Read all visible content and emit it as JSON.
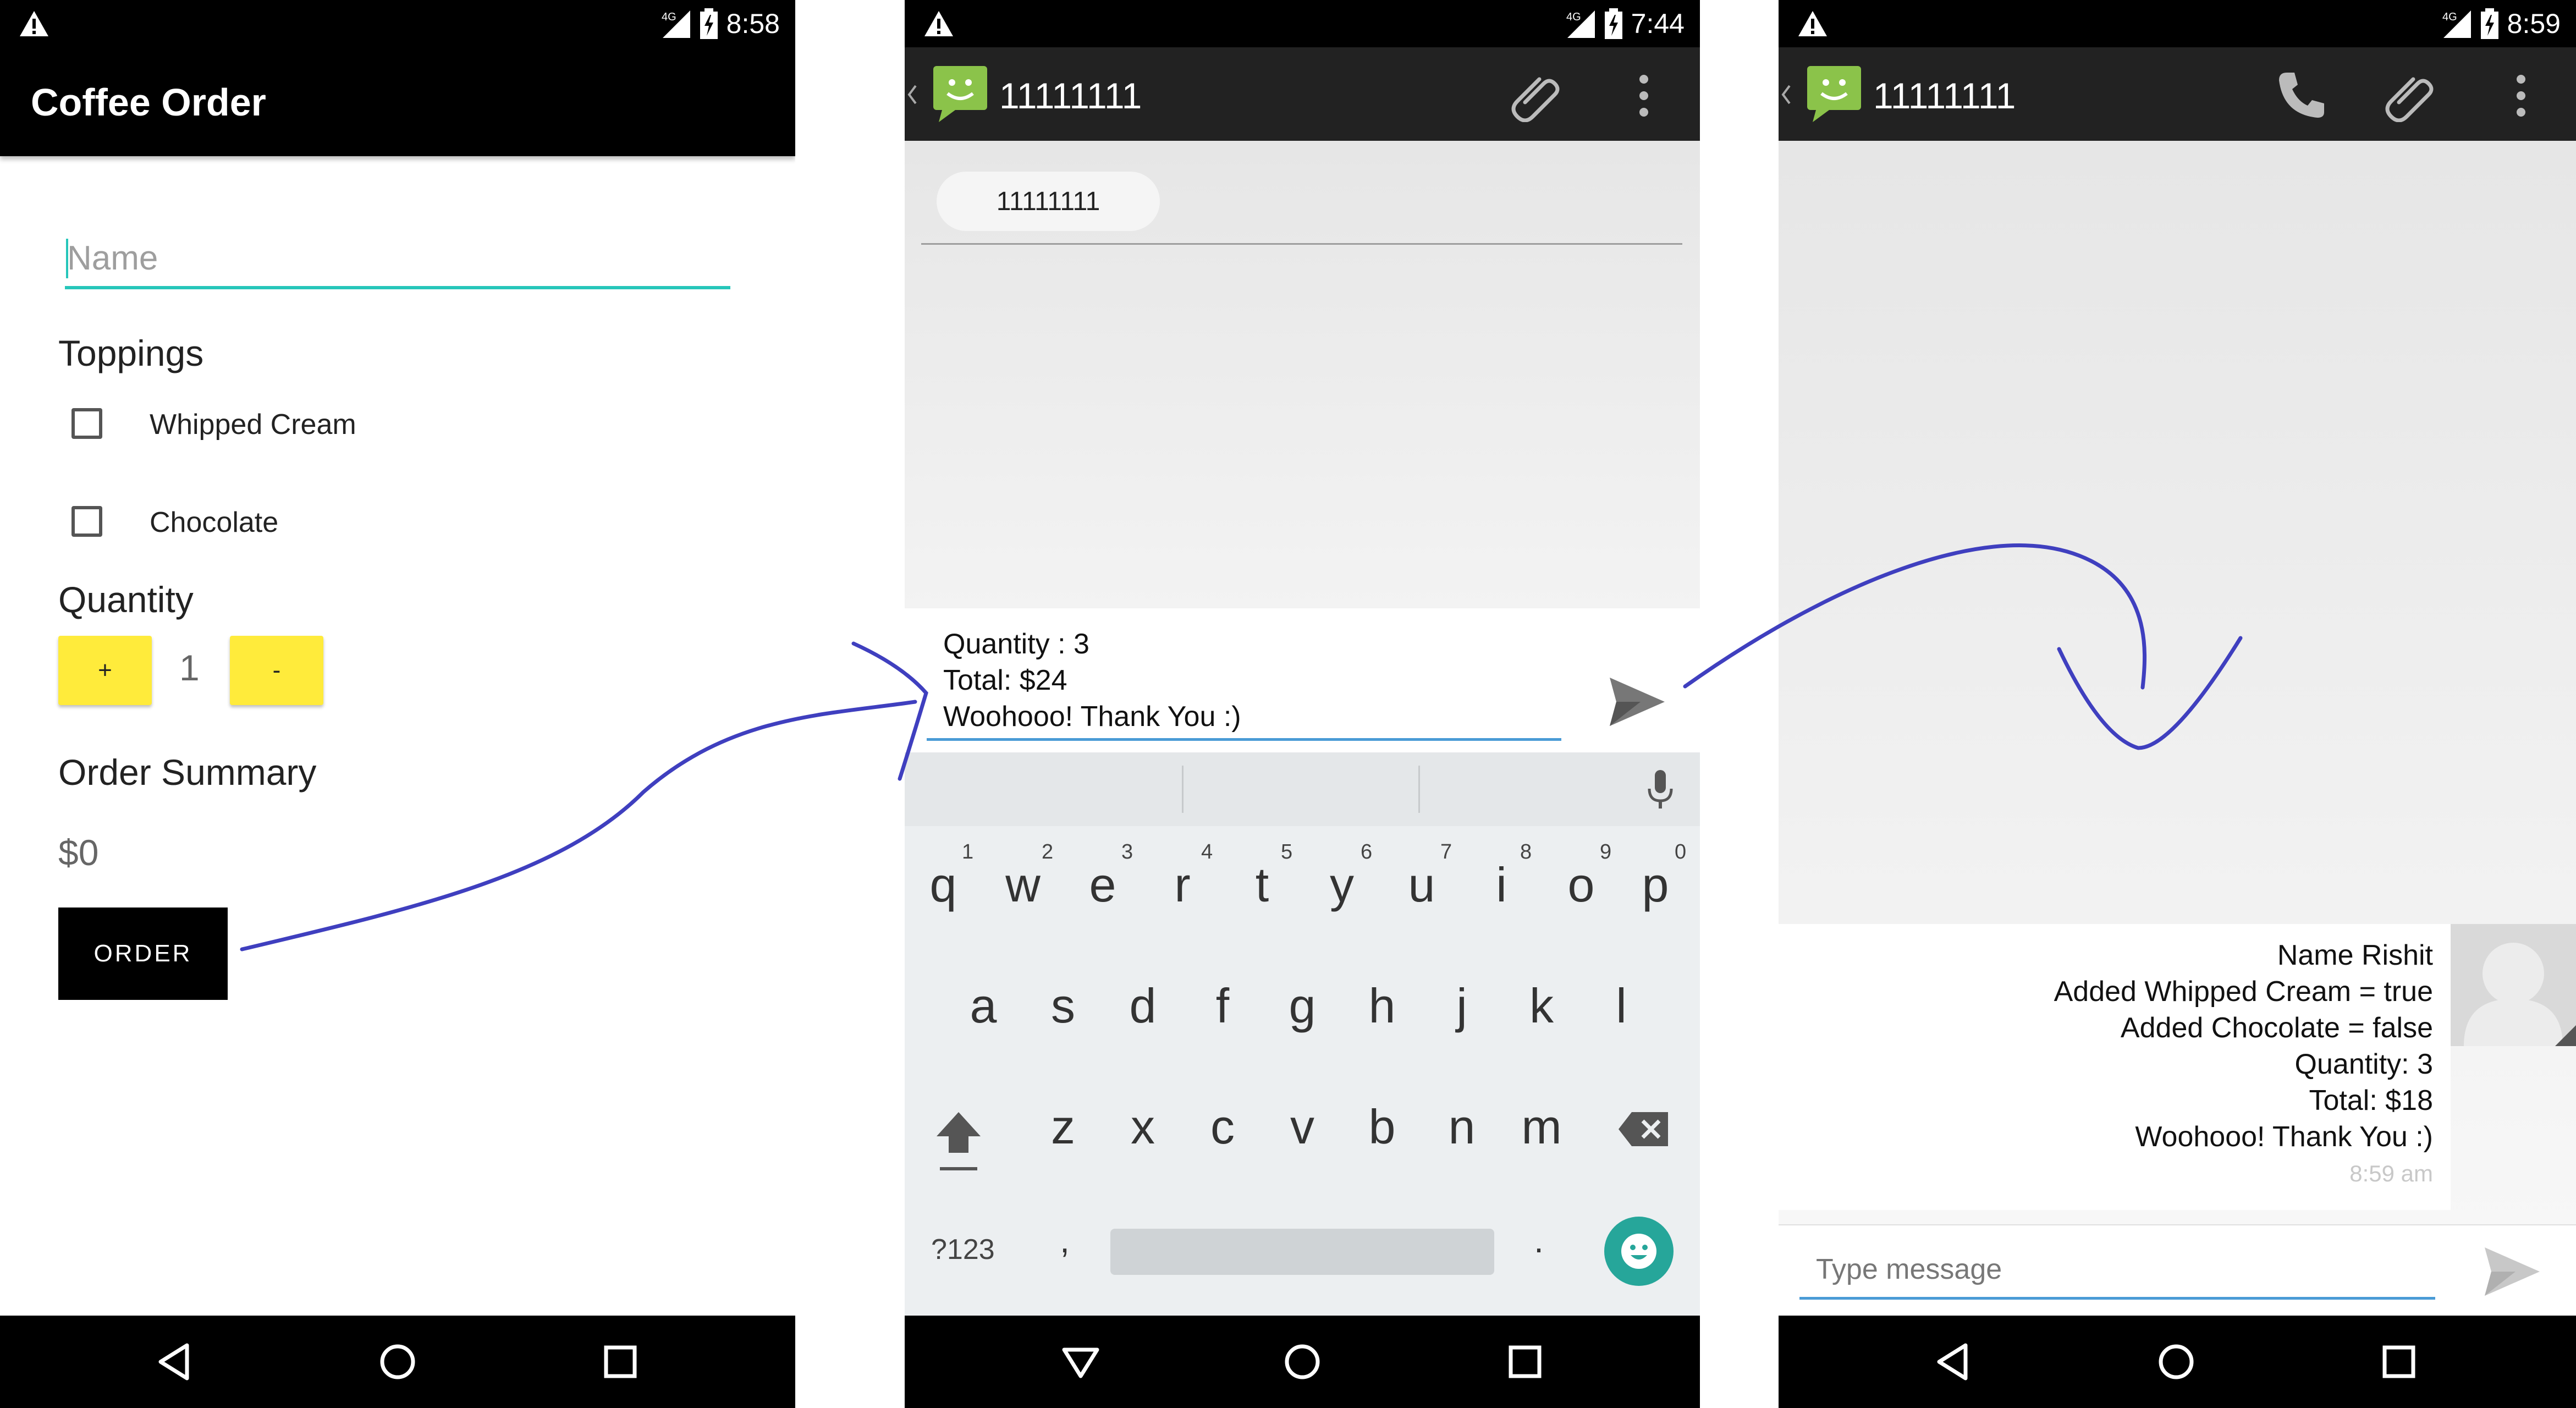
{
  "phone1": {
    "status": {
      "time": "8:58",
      "network": "4G"
    },
    "app_title": "Coffee Order",
    "name_placeholder": "Name",
    "toppings_heading": "Toppings",
    "toppings": [
      {
        "label": "Whipped Cream",
        "checked": false
      },
      {
        "label": "Chocolate",
        "checked": false
      }
    ],
    "quantity_heading": "Quantity",
    "plus_label": "+",
    "quantity_value": "1",
    "minus_label": "-",
    "summary_heading": "Order Summary",
    "price": "$0",
    "order_button": "ORDER",
    "button_color": "#FFEB3B",
    "accent_color": "#26C6BA"
  },
  "phone2": {
    "status": {
      "time": "7:44",
      "network": "4G"
    },
    "contact": "11111111",
    "recipient_chip": "11111111",
    "compose_lines": [
      "Quantity : 3",
      "Total: $24",
      "Woohooo! Thank You :)"
    ],
    "keyboard": {
      "row1": [
        "q",
        "w",
        "e",
        "r",
        "t",
        "y",
        "u",
        "i",
        "o",
        "p"
      ],
      "row1_hints": [
        "1",
        "2",
        "3",
        "4",
        "5",
        "6",
        "7",
        "8",
        "9",
        "0"
      ],
      "row2": [
        "a",
        "s",
        "d",
        "f",
        "g",
        "h",
        "j",
        "k",
        "l"
      ],
      "row3": [
        "z",
        "x",
        "c",
        "v",
        "b",
        "n",
        "m"
      ],
      "symbols_label": "?123",
      "comma": ",",
      "period": "."
    }
  },
  "phone3": {
    "status": {
      "time": "8:59",
      "network": "4G"
    },
    "contact": "11111111",
    "message_lines": [
      "Name Rishit",
      "Added Whipped Cream = true",
      "Added Chocolate = false",
      "Quantity: 3",
      "Total: $18",
      "Woohooo! Thank You :)"
    ],
    "message_time": "8:59 am",
    "input_placeholder": "Type message"
  },
  "colors": {
    "sms_green": "#8BC34A",
    "arrow_blue": "#3F3FBF",
    "input_underline": "#4A9BD6",
    "emoji_teal": "#26A69A"
  }
}
